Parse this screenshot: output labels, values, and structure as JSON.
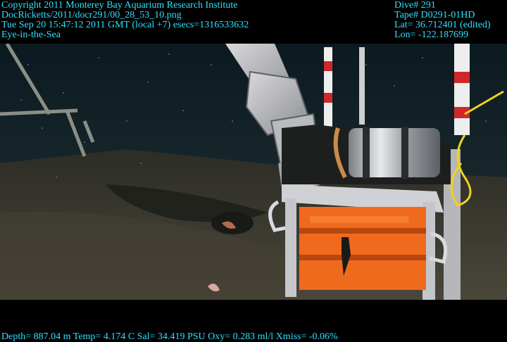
{
  "overlay": {
    "color": "#2fe0ff",
    "left_lines": [
      "Copyright 2011 Monterey Bay Aquarium Research Institute",
      "DocRicketts/2011/docr291/00_28_53_10.png",
      "Tue Sep 20 15:47:12 2011 GMT (local +7)  esecs=1316533632",
      "Eye-in-the-Sea"
    ],
    "right_lines": [
      "Dive# 291",
      "Tape# D0291-01HD",
      "Lat= 36.712401 (edited)",
      "Lon= -122.187699"
    ],
    "footer": "Depth= 887.04 m  Temp= 4.174 C  Sal= 34.419 PSU  Oxy= 0.283 ml/l  Xmiss= -0.06%"
  },
  "scene": {
    "water_color": "#0f1c22",
    "seafloor_color": "#3b3a30",
    "housing_color": "#d8d8dc",
    "crate_color": "#f06a1e",
    "cable_color": "#f2d21a"
  }
}
